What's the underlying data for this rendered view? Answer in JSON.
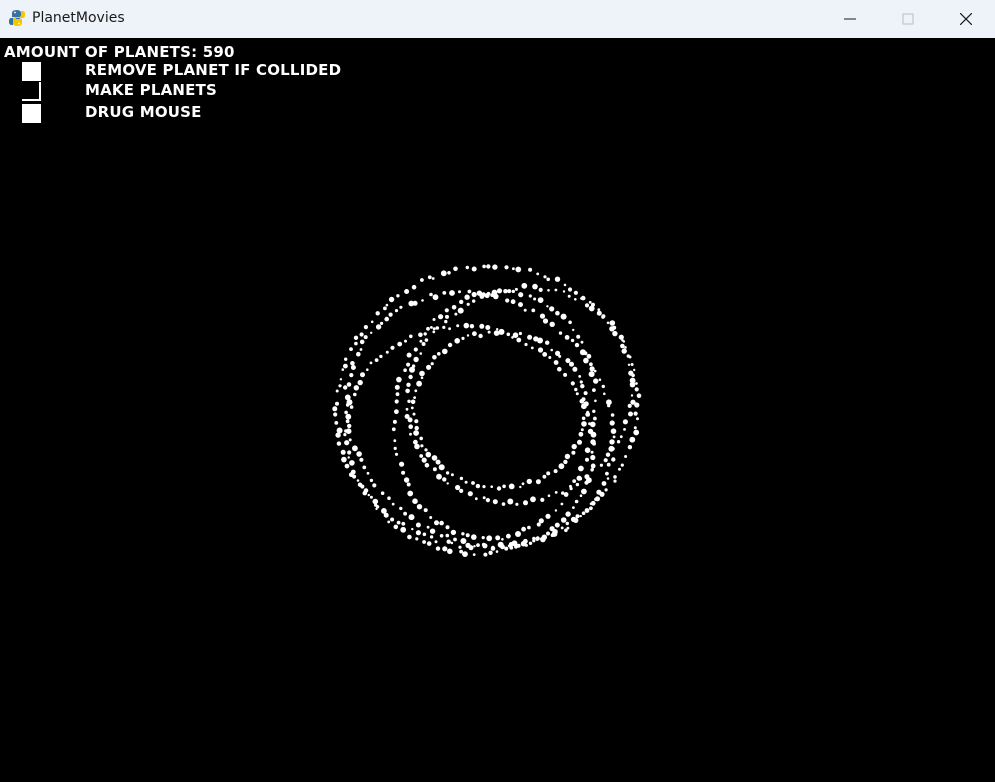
{
  "window": {
    "title": "PlanetMovies",
    "icon": "python-snake-icon",
    "controls": [
      "minimize-icon",
      "maximize-icon",
      "close-icon"
    ]
  },
  "hud": {
    "planet_count_label": "AMOUNT OF PLANETS: 590",
    "options": [
      {
        "label": "REMOVE PLANET IF COLLIDED",
        "checked": true
      },
      {
        "label": "MAKE PLANETS",
        "checked": false
      },
      {
        "label": "DRUG MOUSE",
        "checked": true
      }
    ]
  },
  "colors": {
    "titlebar": "#eef2f9",
    "background": "#000000",
    "foreground": "#ffffff"
  }
}
